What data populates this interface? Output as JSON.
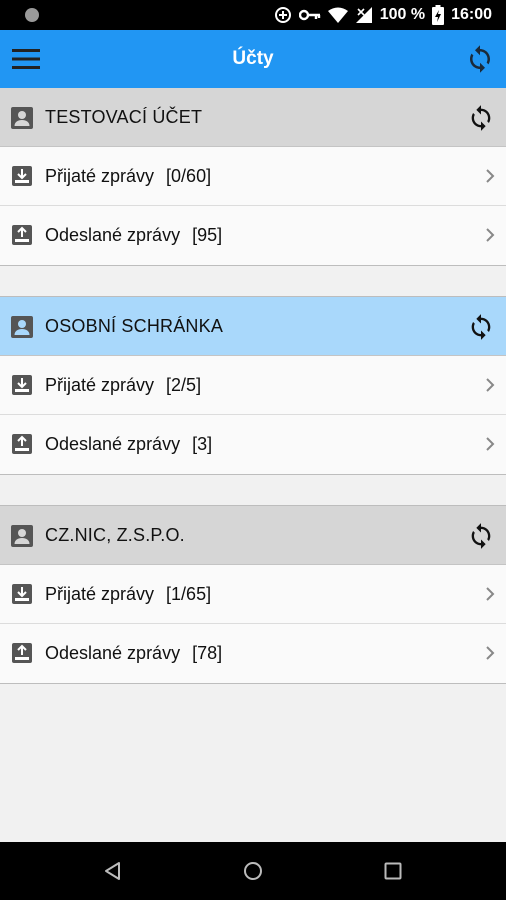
{
  "status": {
    "battery": "100 %",
    "time": "16:00"
  },
  "header": {
    "title": "Účty"
  },
  "accounts": [
    {
      "name": "TESTOVACÍ ÚČET",
      "selected": false,
      "rows": [
        {
          "label": "Přijaté zprávy",
          "count": "[0/60]"
        },
        {
          "label": "Odeslané zprávy",
          "count": "[95]"
        }
      ]
    },
    {
      "name": "OSOBNÍ SCHRÁNKA",
      "selected": true,
      "rows": [
        {
          "label": "Přijaté zprávy",
          "count": "[2/5]"
        },
        {
          "label": "Odeslané zprávy",
          "count": "[3]"
        }
      ]
    },
    {
      "name": "CZ.NIC, Z.S.P.O.",
      "selected": false,
      "rows": [
        {
          "label": "Přijaté zprávy",
          "count": "[1/65]"
        },
        {
          "label": "Odeslané zprávy",
          "count": "[78]"
        }
      ]
    }
  ],
  "colors": {
    "app_bar": "#2196f3",
    "selected_header": "#a9d8fb",
    "header": "#d6d6d6"
  }
}
